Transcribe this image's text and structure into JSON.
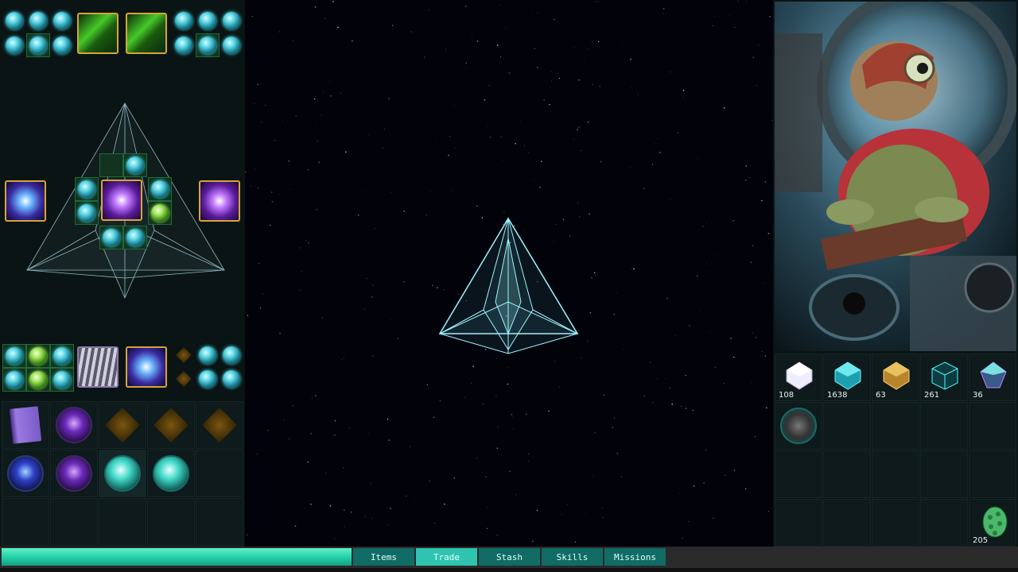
{
  "tabs": [
    {
      "label": "Items",
      "active": false
    },
    {
      "label": "Trade",
      "active": true
    },
    {
      "label": "Stash",
      "active": false
    },
    {
      "label": "Skills",
      "active": false
    },
    {
      "label": "Missions",
      "active": false
    }
  ],
  "resources": [
    {
      "icon": "white-crystal-icon",
      "count": "108"
    },
    {
      "icon": "cyan-crystal-icon",
      "count": "1638"
    },
    {
      "icon": "gold-ore-icon",
      "count": "63"
    },
    {
      "icon": "tech-cube-icon",
      "count": "261"
    },
    {
      "icon": "prism-crystal-icon",
      "count": "36"
    }
  ],
  "trade_item_icon": "asteroid-orb-icon",
  "egg": {
    "icon": "green-egg-icon",
    "count": "205"
  },
  "energy_level": 1.0,
  "colors": {
    "panel_bg": "#0b1414",
    "slot_border": "#1d6b35",
    "tab_active": "#2ec4b0",
    "tab_inactive": "#106c64",
    "energy_bar": "#1ec9a2",
    "item_frame": "#d8a43a"
  }
}
